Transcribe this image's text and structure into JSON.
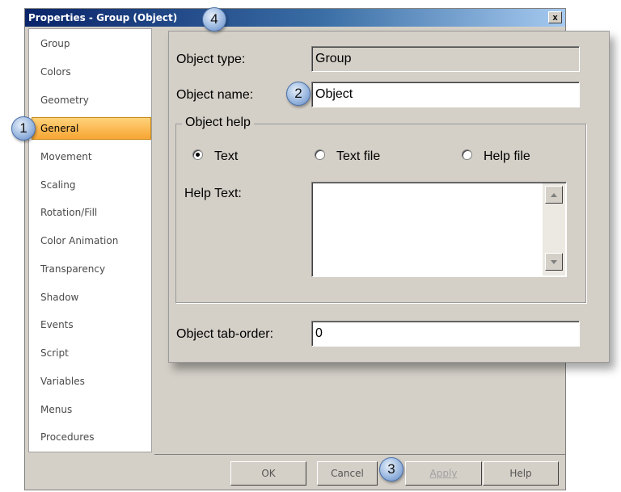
{
  "dialog": {
    "title": "Properties - Group (Object)",
    "close_label": "x"
  },
  "sidebar": {
    "items": [
      {
        "label": "Group"
      },
      {
        "label": "Colors"
      },
      {
        "label": "Geometry"
      },
      {
        "label": "General",
        "selected": true
      },
      {
        "label": "Movement"
      },
      {
        "label": "Scaling"
      },
      {
        "label": "Rotation/Fill"
      },
      {
        "label": "Color Animation"
      },
      {
        "label": "Transparency"
      },
      {
        "label": "Shadow"
      },
      {
        "label": "Events"
      },
      {
        "label": "Script"
      },
      {
        "label": "Variables"
      },
      {
        "label": "Menus"
      },
      {
        "label": "Procedures"
      }
    ]
  },
  "general": {
    "object_type_label": "Object type:",
    "object_type_value": "Group",
    "object_name_label": "Object name:",
    "object_name_value": "Object",
    "help_group_label": "Object help",
    "radio_text_label": "Text",
    "radio_textfile_label": "Text file",
    "radio_helpfile_label": "Help file",
    "selected_radio": "Text",
    "help_text_label": "Help Text:",
    "help_text_value": "",
    "tab_order_label": "Object tab-order:",
    "tab_order_value": "0"
  },
  "buttons": {
    "ok": "OK",
    "cancel": "Cancel",
    "apply": "Apply",
    "help": "Help"
  },
  "callouts": [
    "1",
    "2",
    "3",
    "4"
  ],
  "colors": {
    "title_bar": "#0a246a",
    "selected_item": "#f7a533",
    "dialog_bg": "#d4d0c8",
    "callout": "#9cb9e0"
  }
}
